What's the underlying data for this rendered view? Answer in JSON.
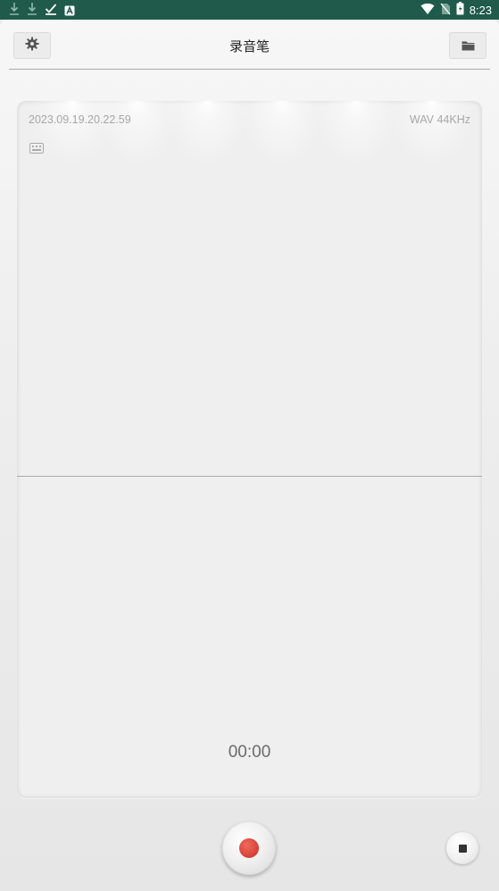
{
  "status_bar": {
    "time": "8:23",
    "left_icons": [
      "download-icon",
      "download-icon",
      "check-icon",
      "a-icon"
    ],
    "right_icons": [
      "wifi-icon",
      "no-sim-icon",
      "battery-icon"
    ]
  },
  "header": {
    "title": "录音笔",
    "left_button_icon": "gear-icon",
    "right_button_icon": "folder-icon"
  },
  "recorder_panel": {
    "timestamp": "2023.09.19.20.22.59",
    "format": "WAV 44KHz",
    "timer": "00:00",
    "small_icon": "keyboard-icon"
  },
  "controls": {
    "record_icon": "record-icon",
    "stop_icon": "stop-icon",
    "record_color": "#d9453a"
  },
  "colors": {
    "status_bar": "#1f5a4a",
    "background": "#e9e9e9"
  }
}
